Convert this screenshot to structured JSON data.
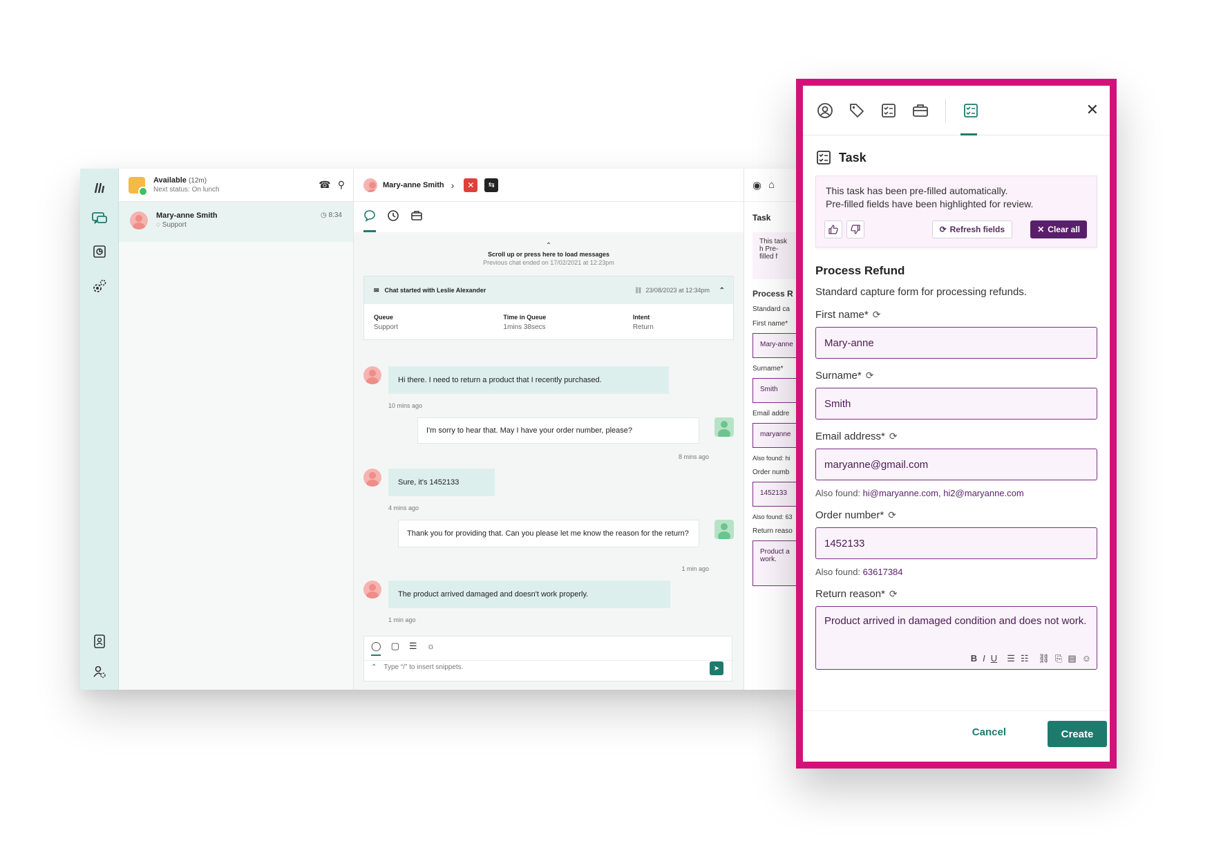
{
  "app": {
    "status": {
      "label": "Available",
      "duration": "(12m)",
      "next": "Next status: On lunch"
    },
    "conversation": {
      "name": "Mary-anne Smith",
      "queue": "Support",
      "time": "8:34"
    },
    "chat": {
      "contact_name": "Mary-anne Smith",
      "load_more": "Scroll up or press here to load messages",
      "previous": "Previous chat ended on 17/02/2021 at 12:23pm",
      "card": {
        "title": "Chat started with Leslie Alexander",
        "date": "23/08/2023 at 12:34pm",
        "cols": [
          {
            "key": "Queue",
            "value": "Support"
          },
          {
            "key": "Time in Queue",
            "value": "1mins 38secs"
          },
          {
            "key": "Intent",
            "value": "Return"
          }
        ]
      },
      "messages": [
        {
          "text": "Hi there. I need to return a product that I recently purchased.",
          "time": "10 mins ago"
        },
        {
          "text": "I'm sorry to hear that. May I have your order number, please?",
          "time": "8 mins ago"
        },
        {
          "text": "Sure, it's 1452133",
          "time": "4 mins ago"
        },
        {
          "text": "Thank you for providing that. Can you please let me know the reason for the return?",
          "time": "1 min ago"
        },
        {
          "text": "The product arrived damaged and doesn't work properly.",
          "time": "1 min ago"
        }
      ],
      "composer_placeholder": "Type “/” to insert snippets."
    },
    "peek": {
      "title": "Task",
      "notice": "This task h Pre-filled f",
      "section": "Process R",
      "desc": "Standard ca",
      "first_label": "First name*",
      "first_value": "Mary-anne",
      "surname_label": "Surname*",
      "surname_value": "Smith",
      "email_label": "Email addre",
      "email_value": "maryanne",
      "email_also": "Also found: hi",
      "order_label": "Order numb",
      "order_value": "1452133",
      "order_also": "Also found: 63",
      "reason_label": "Return reaso",
      "reason_value": "Product a work."
    }
  },
  "panel": {
    "title": "Task",
    "notice": {
      "line1": "This task has been pre-filled automatically.",
      "line2": "Pre-filled fields have been highlighted for review.",
      "refresh": "Refresh fields",
      "clear": "Clear all"
    },
    "form_title": "Process Refund",
    "form_desc": "Standard capture form for processing refunds.",
    "fields": {
      "first_name": {
        "label": "First name*",
        "value": "Mary-anne"
      },
      "surname": {
        "label": "Surname*",
        "value": "Smith"
      },
      "email": {
        "label": "Email address*",
        "value": "maryanne@gmail.com",
        "also_prefix": "Also found:",
        "also": "hi@maryanne.com, hi2@maryanne.com"
      },
      "order": {
        "label": "Order number*",
        "value": "1452133",
        "also_prefix": "Also found:",
        "also": "63617384"
      },
      "reason": {
        "label": "Return reason*",
        "value": "Product arrived in damaged condition and does not work."
      }
    },
    "cancel": "Cancel",
    "create": "Create"
  },
  "icons": {
    "rail": [
      "logo-icon",
      "chat-icon",
      "reports-icon",
      "settings-icon",
      "contacts-icon",
      "admin-icon"
    ],
    "panel_tabs": [
      "profile-icon",
      "tag-icon",
      "checklist-icon",
      "briefcase-icon",
      "task-icon"
    ]
  },
  "colors": {
    "accent": "#1f7a6e",
    "highlight_border": "#d3117b",
    "prefill_purple": "#5a1f6a"
  }
}
